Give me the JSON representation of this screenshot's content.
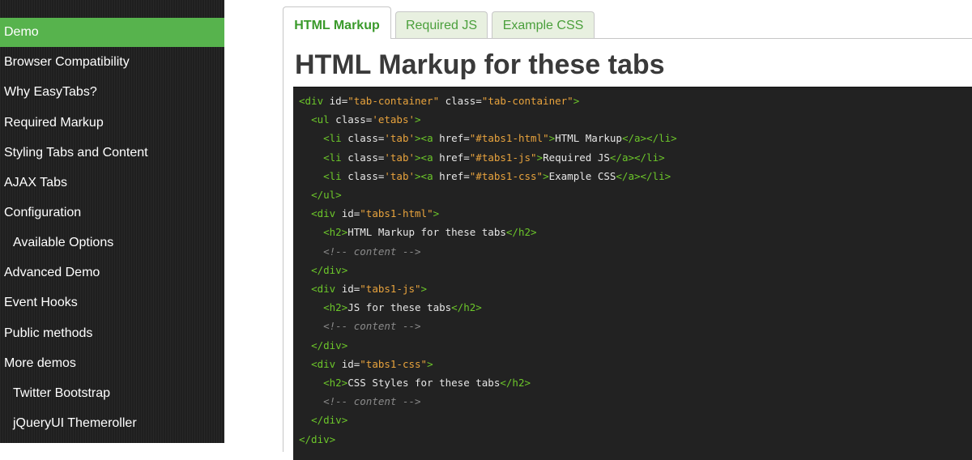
{
  "sidebar": {
    "items": [
      {
        "label": "Demo",
        "active": true,
        "sub": false
      },
      {
        "label": "Browser Compatibility",
        "active": false,
        "sub": false
      },
      {
        "label": "Why EasyTabs?",
        "active": false,
        "sub": false
      },
      {
        "label": "Required Markup",
        "active": false,
        "sub": false
      },
      {
        "label": "Styling Tabs and Content",
        "active": false,
        "sub": false
      },
      {
        "label": "AJAX Tabs",
        "active": false,
        "sub": false
      },
      {
        "label": "Configuration",
        "active": false,
        "sub": false
      },
      {
        "label": "Available Options",
        "active": false,
        "sub": true
      },
      {
        "label": "Advanced Demo",
        "active": false,
        "sub": false
      },
      {
        "label": "Event Hooks",
        "active": false,
        "sub": false
      },
      {
        "label": "Public methods",
        "active": false,
        "sub": false
      },
      {
        "label": "More demos",
        "active": false,
        "sub": false
      },
      {
        "label": "Twitter Bootstrap",
        "active": false,
        "sub": true
      },
      {
        "label": "jQueryUI Themeroller",
        "active": false,
        "sub": true
      }
    ]
  },
  "tabs": [
    {
      "label": "HTML Markup",
      "active": true
    },
    {
      "label": "Required JS",
      "active": false
    },
    {
      "label": "Example CSS",
      "active": false
    }
  ],
  "panel": {
    "title": "HTML Markup for these tabs"
  },
  "code": {
    "lines": [
      [
        [
          "tg",
          "<div "
        ],
        [
          "at",
          "id="
        ],
        [
          "vl",
          "\"tab-container\""
        ],
        [
          "at",
          " class="
        ],
        [
          "vl",
          "\"tab-container\""
        ],
        [
          "tg",
          ">"
        ]
      ],
      [
        [
          "tx",
          "  "
        ],
        [
          "tg",
          "<ul "
        ],
        [
          "at",
          "class="
        ],
        [
          "vl",
          "'etabs'"
        ],
        [
          "tg",
          ">"
        ]
      ],
      [
        [
          "tx",
          "    "
        ],
        [
          "tg",
          "<li "
        ],
        [
          "at",
          "class="
        ],
        [
          "vl",
          "'tab'"
        ],
        [
          "tg",
          ">"
        ],
        [
          "tg",
          "<a "
        ],
        [
          "at",
          "href="
        ],
        [
          "vl",
          "\"#tabs1-html\""
        ],
        [
          "tg",
          ">"
        ],
        [
          "tx",
          "HTML Markup"
        ],
        [
          "tg",
          "</a></li>"
        ]
      ],
      [
        [
          "tx",
          "    "
        ],
        [
          "tg",
          "<li "
        ],
        [
          "at",
          "class="
        ],
        [
          "vl",
          "'tab'"
        ],
        [
          "tg",
          ">"
        ],
        [
          "tg",
          "<a "
        ],
        [
          "at",
          "href="
        ],
        [
          "vl",
          "\"#tabs1-js\""
        ],
        [
          "tg",
          ">"
        ],
        [
          "tx",
          "Required JS"
        ],
        [
          "tg",
          "</a></li>"
        ]
      ],
      [
        [
          "tx",
          "    "
        ],
        [
          "tg",
          "<li "
        ],
        [
          "at",
          "class="
        ],
        [
          "vl",
          "'tab'"
        ],
        [
          "tg",
          ">"
        ],
        [
          "tg",
          "<a "
        ],
        [
          "at",
          "href="
        ],
        [
          "vl",
          "\"#tabs1-css\""
        ],
        [
          "tg",
          ">"
        ],
        [
          "tx",
          "Example CSS"
        ],
        [
          "tg",
          "</a></li>"
        ]
      ],
      [
        [
          "tx",
          "  "
        ],
        [
          "tg",
          "</ul>"
        ]
      ],
      [
        [
          "tx",
          "  "
        ],
        [
          "tg",
          "<div "
        ],
        [
          "at",
          "id="
        ],
        [
          "vl",
          "\"tabs1-html\""
        ],
        [
          "tg",
          ">"
        ]
      ],
      [
        [
          "tx",
          "    "
        ],
        [
          "tg",
          "<h2>"
        ],
        [
          "tx",
          "HTML Markup for these tabs"
        ],
        [
          "tg",
          "</h2>"
        ]
      ],
      [
        [
          "tx",
          "    "
        ],
        [
          "cm",
          "<!-- content -->"
        ]
      ],
      [
        [
          "tx",
          "  "
        ],
        [
          "tg",
          "</div>"
        ]
      ],
      [
        [
          "tx",
          "  "
        ],
        [
          "tg",
          "<div "
        ],
        [
          "at",
          "id="
        ],
        [
          "vl",
          "\"tabs1-js\""
        ],
        [
          "tg",
          ">"
        ]
      ],
      [
        [
          "tx",
          "    "
        ],
        [
          "tg",
          "<h2>"
        ],
        [
          "tx",
          "JS for these tabs"
        ],
        [
          "tg",
          "</h2>"
        ]
      ],
      [
        [
          "tx",
          "    "
        ],
        [
          "cm",
          "<!-- content -->"
        ]
      ],
      [
        [
          "tx",
          "  "
        ],
        [
          "tg",
          "</div>"
        ]
      ],
      [
        [
          "tx",
          "  "
        ],
        [
          "tg",
          "<div "
        ],
        [
          "at",
          "id="
        ],
        [
          "vl",
          "\"tabs1-css\""
        ],
        [
          "tg",
          ">"
        ]
      ],
      [
        [
          "tx",
          "    "
        ],
        [
          "tg",
          "<h2>"
        ],
        [
          "tx",
          "CSS Styles for these tabs"
        ],
        [
          "tg",
          "</h2>"
        ]
      ],
      [
        [
          "tx",
          "    "
        ],
        [
          "cm",
          "<!-- content -->"
        ]
      ],
      [
        [
          "tx",
          "  "
        ],
        [
          "tg",
          "</div>"
        ]
      ],
      [
        [
          "tg",
          "</div>"
        ]
      ]
    ]
  }
}
